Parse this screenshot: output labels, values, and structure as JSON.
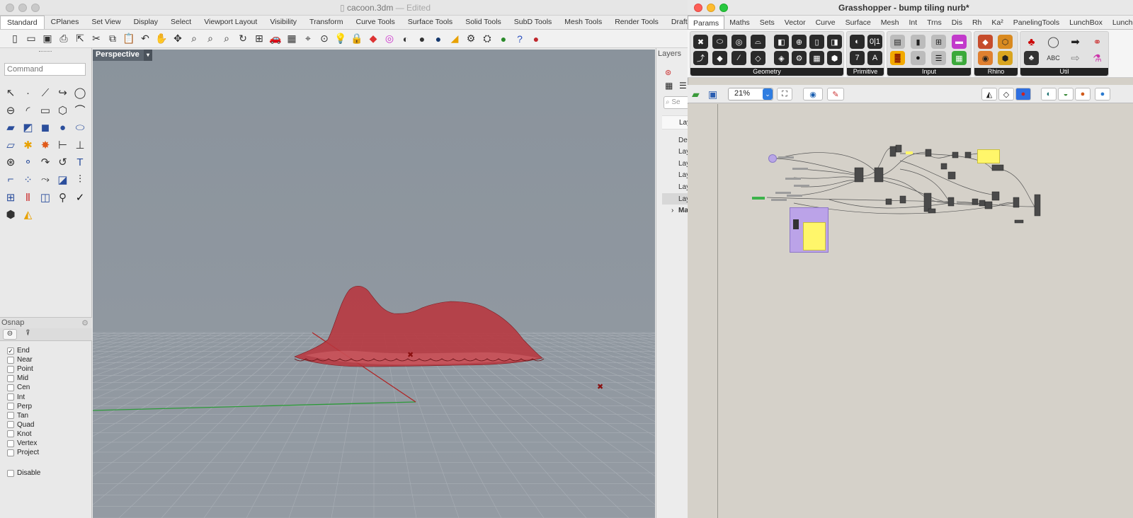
{
  "rhino": {
    "file_name": "cacoon.3dm",
    "status": "— Edited",
    "tabs": [
      "Standard",
      "CPlanes",
      "Set View",
      "Display",
      "Select",
      "Viewport Layout",
      "Visibility",
      "Transform",
      "Curve Tools",
      "Surface Tools",
      "Solid Tools",
      "SubD Tools",
      "Mesh Tools",
      "Render Tools",
      "Drafting"
    ],
    "command_placeholder": "Command",
    "viewport_label": "Perspective",
    "osnap": {
      "title": "Osnap",
      "items": [
        {
          "label": "End",
          "checked": true
        },
        {
          "label": "Near",
          "checked": false
        },
        {
          "label": "Point",
          "checked": false
        },
        {
          "label": "Mid",
          "checked": false
        },
        {
          "label": "Cen",
          "checked": false
        },
        {
          "label": "Int",
          "checked": false
        },
        {
          "label": "Perp",
          "checked": false
        },
        {
          "label": "Tan",
          "checked": false
        },
        {
          "label": "Quad",
          "checked": false
        },
        {
          "label": "Knot",
          "checked": false
        },
        {
          "label": "Vertex",
          "checked": false
        },
        {
          "label": "Project",
          "checked": false
        }
      ],
      "disable_label": "Disable"
    },
    "layers": {
      "title": "Layers",
      "search": "Se",
      "header": "Lay",
      "rows": [
        "De",
        "Lay",
        "Lay",
        "Lay",
        "Lay",
        "Lay",
        "Ma"
      ]
    }
  },
  "grasshopper": {
    "title": "Grasshopper - bump tiling nurb*",
    "tabs": [
      "Params",
      "Maths",
      "Sets",
      "Vector",
      "Curve",
      "Surface",
      "Mesh",
      "Int",
      "Trns",
      "Dis",
      "Rh",
      "Ka²",
      "PanelingTools",
      "LunchBox",
      "LunchBoxML"
    ],
    "groups": [
      "Geometry",
      "Primitive",
      "Input",
      "Rhino",
      "Util"
    ],
    "zoom": "21%"
  },
  "colors": {
    "surface": "#b8353d",
    "canvas": "#d5d1c9",
    "viewport": "#8d959e"
  }
}
